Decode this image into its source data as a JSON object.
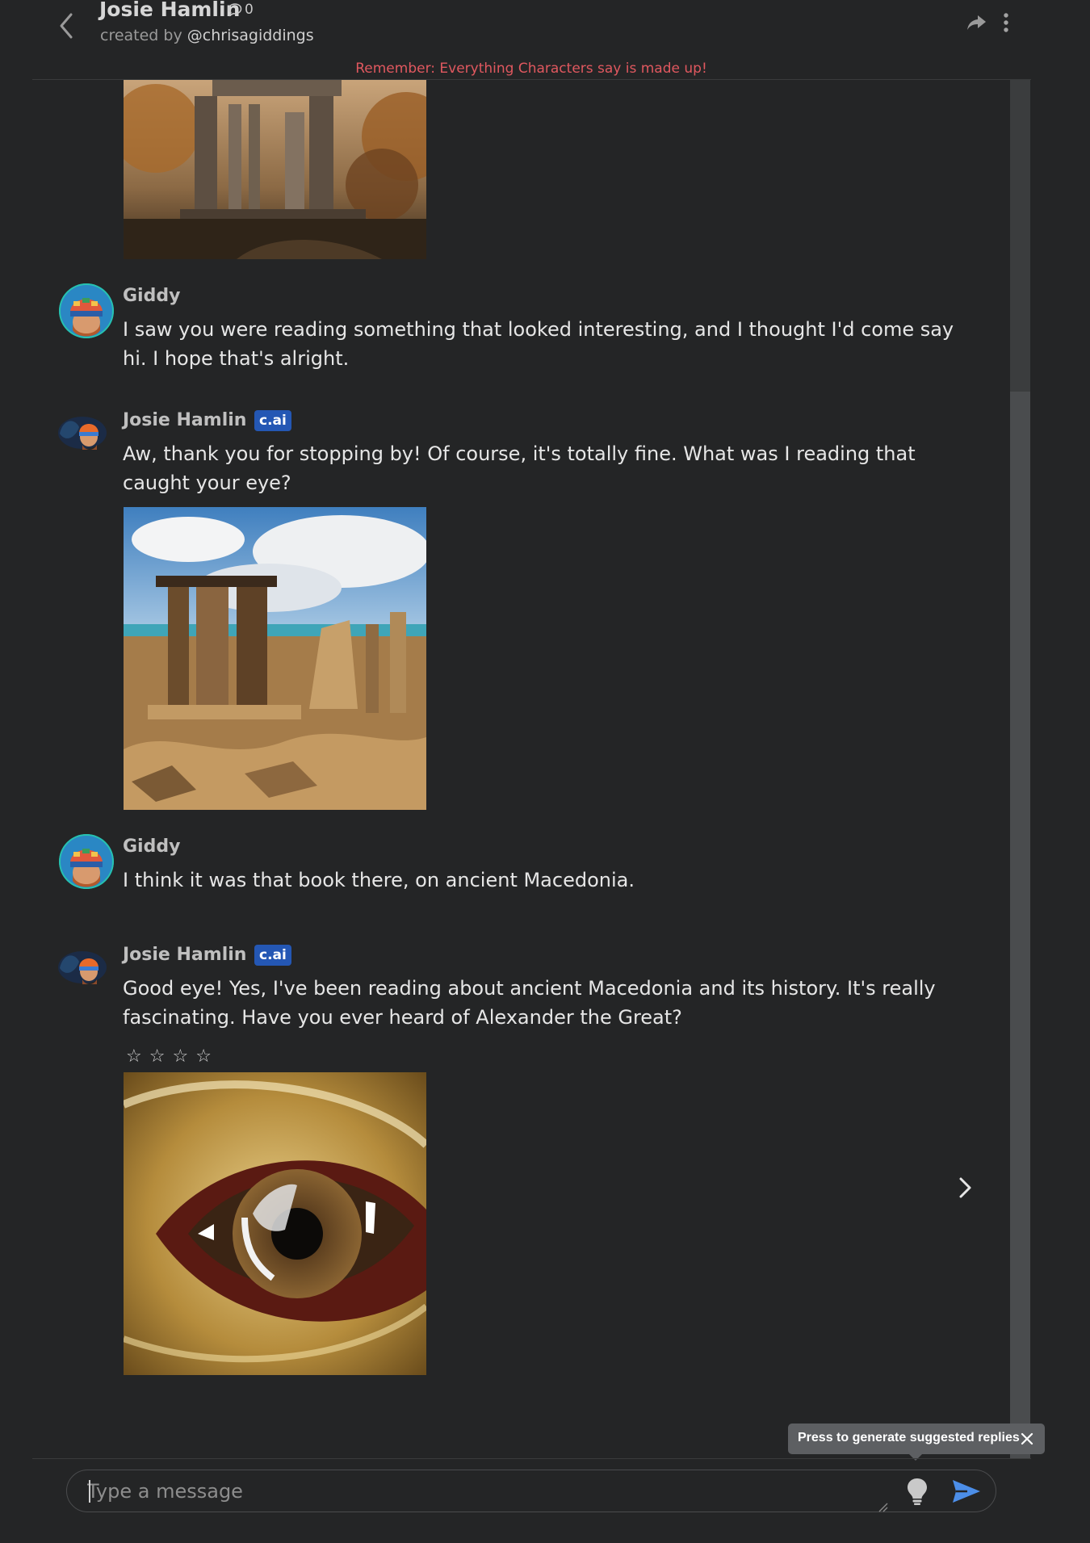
{
  "header": {
    "title": "Josie Hamlin",
    "chat_count": "0",
    "created_by_prefix": "created by",
    "creator_handle": "@chrisagiddings",
    "disclaimer": "Remember: Everything Characters say is made up!"
  },
  "messages": [
    {
      "type": "image",
      "alt": "Ancient stone ruins in a warm autumn landscape"
    },
    {
      "sender": "Giddy",
      "is_ai": false,
      "text": "I saw you were reading something that looked interesting, and I thought I'd come say hi. I hope that's alright."
    },
    {
      "sender": "Josie Hamlin",
      "is_ai": true,
      "badge": "c.ai",
      "text": "Aw, thank you for stopping by! Of course, it's totally fine. What was I reading that caught your eye?",
      "image_alt": "Ancient Greek ruins by the sea under a cloudy sky"
    },
    {
      "sender": "Giddy",
      "is_ai": false,
      "text": "I think it was that book there, on ancient Macedonia."
    },
    {
      "sender": "Josie Hamlin",
      "is_ai": true,
      "badge": "c.ai",
      "text": "Good eye! Yes, I've been reading about ancient Macedonia and its history. It's really fascinating. Have you ever heard of Alexander the Great?",
      "rating": {
        "stars": [
          "☆",
          "☆",
          "☆",
          "☆"
        ],
        "value": 0,
        "max": 4
      },
      "image_alt": "Close-up of a golden eye"
    }
  ],
  "tooltip": {
    "text": "Press to generate suggested replies"
  },
  "input": {
    "placeholder": "Type a message",
    "value": ""
  },
  "icons": {
    "back": "chevron-left-icon",
    "chat_count": "speech-bubble-icon",
    "share": "share-arrow-icon",
    "more": "vertical-dots-icon",
    "next": "chevron-right-icon",
    "close": "close-icon",
    "hint": "lightbulb-icon",
    "send": "paper-plane-icon"
  },
  "colors": {
    "background": "#242526",
    "disclaimer": "#e0585f",
    "badge": "#2457b4",
    "send": "#4c8ee8",
    "tooltip": "#5d5f62"
  }
}
